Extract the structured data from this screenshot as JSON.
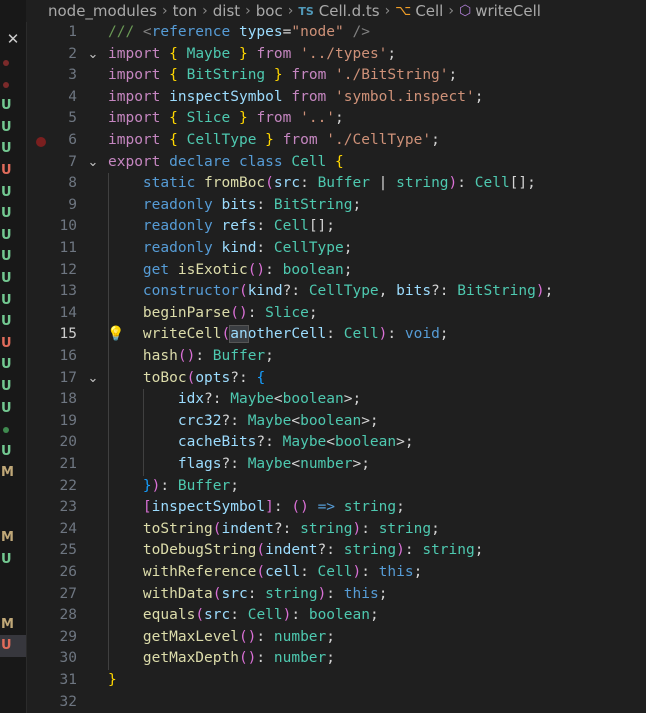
{
  "breadcrumb": {
    "items": [
      "node_modules",
      "ton",
      "dist",
      "boc"
    ],
    "file_badge": "TS",
    "file": "Cell.d.ts",
    "class_symbol": "Cell",
    "method_symbol": "writeCell"
  },
  "left_strip": {
    "close_glyph": "✕",
    "markers": [
      {
        "label": "",
        "kind": "dot-red"
      },
      {
        "label": "",
        "kind": "dot-red"
      },
      {
        "label": "U",
        "kind": "untracked"
      },
      {
        "label": "U",
        "kind": "untracked"
      },
      {
        "label": "U",
        "kind": "untracked"
      },
      {
        "label": "U",
        "kind": "deleted"
      },
      {
        "label": "U",
        "kind": "untracked"
      },
      {
        "label": "U",
        "kind": "untracked"
      },
      {
        "label": "U",
        "kind": "untracked"
      },
      {
        "label": "U",
        "kind": "untracked"
      },
      {
        "label": "U",
        "kind": "untracked"
      },
      {
        "label": "U",
        "kind": "untracked"
      },
      {
        "label": "U",
        "kind": "untracked"
      },
      {
        "label": "U",
        "kind": "deleted"
      },
      {
        "label": "U",
        "kind": "untracked"
      },
      {
        "label": "U",
        "kind": "untracked"
      },
      {
        "label": "U",
        "kind": "untracked"
      },
      {
        "label": "",
        "kind": "dot-green"
      },
      {
        "label": "U",
        "kind": "untracked"
      },
      {
        "label": "M",
        "kind": "modified"
      },
      {
        "label": "",
        "kind": "none"
      },
      {
        "label": "",
        "kind": "none"
      },
      {
        "label": "M",
        "kind": "modified"
      },
      {
        "label": "U",
        "kind": "untracked"
      },
      {
        "label": "",
        "kind": "none"
      },
      {
        "label": "",
        "kind": "none"
      },
      {
        "label": "M",
        "kind": "modified"
      },
      {
        "label": "U",
        "kind": "deleted"
      }
    ],
    "colors": {
      "untracked": "#73c991",
      "deleted": "#e06c5b",
      "modified": "#c0a878",
      "dot-red": "#7a2a2a",
      "dot-green": "#3f8a4f"
    }
  },
  "editor": {
    "active_line": 15,
    "breakpoint_line": 6,
    "lightbulb_line": 15,
    "folds": [
      2,
      7,
      17
    ],
    "lines": [
      [
        [
          "cm",
          "/// "
        ],
        [
          "tag",
          "<"
        ],
        [
          "xtag",
          "reference"
        ],
        [
          "cm",
          " "
        ],
        [
          "vr",
          "types"
        ],
        [
          "pn",
          "="
        ],
        [
          "st",
          "\"node\""
        ],
        [
          "cm",
          " "
        ],
        [
          "tag",
          "/>"
        ]
      ],
      [
        [
          "ctl",
          "import"
        ],
        [
          "pn",
          " "
        ],
        [
          "b1",
          "{"
        ],
        [
          "pn",
          " "
        ],
        [
          "ty",
          "Maybe"
        ],
        [
          "pn",
          " "
        ],
        [
          "b1",
          "}"
        ],
        [
          "pn",
          " "
        ],
        [
          "ctl",
          "from"
        ],
        [
          "pn",
          " "
        ],
        [
          "st",
          "'../types'"
        ],
        [
          "pn",
          ";"
        ]
      ],
      [
        [
          "ctl",
          "import"
        ],
        [
          "pn",
          " "
        ],
        [
          "b1",
          "{"
        ],
        [
          "pn",
          " "
        ],
        [
          "ty",
          "BitString"
        ],
        [
          "pn",
          " "
        ],
        [
          "b1",
          "}"
        ],
        [
          "pn",
          " "
        ],
        [
          "ctl",
          "from"
        ],
        [
          "pn",
          " "
        ],
        [
          "st",
          "'./BitString'"
        ],
        [
          "pn",
          ";"
        ]
      ],
      [
        [
          "ctl",
          "import"
        ],
        [
          "pn",
          " "
        ],
        [
          "vr",
          "inspectSymbol"
        ],
        [
          "pn",
          " "
        ],
        [
          "ctl",
          "from"
        ],
        [
          "pn",
          " "
        ],
        [
          "st",
          "'symbol.inspect'"
        ],
        [
          "pn",
          ";"
        ]
      ],
      [
        [
          "ctl",
          "import"
        ],
        [
          "pn",
          " "
        ],
        [
          "b1",
          "{"
        ],
        [
          "pn",
          " "
        ],
        [
          "ty",
          "Slice"
        ],
        [
          "pn",
          " "
        ],
        [
          "b1",
          "}"
        ],
        [
          "pn",
          " "
        ],
        [
          "ctl",
          "from"
        ],
        [
          "pn",
          " "
        ],
        [
          "st",
          "'..'"
        ],
        [
          "pn",
          ";"
        ]
      ],
      [
        [
          "ctl",
          "import"
        ],
        [
          "pn",
          " "
        ],
        [
          "b1",
          "{"
        ],
        [
          "pn",
          " "
        ],
        [
          "ty",
          "CellType"
        ],
        [
          "pn",
          " "
        ],
        [
          "b1",
          "}"
        ],
        [
          "pn",
          " "
        ],
        [
          "ctl",
          "from"
        ],
        [
          "pn",
          " "
        ],
        [
          "st",
          "'./CellType'"
        ],
        [
          "pn",
          ";"
        ]
      ],
      [
        [
          "ctl",
          "export"
        ],
        [
          "pn",
          " "
        ],
        [
          "kw",
          "declare"
        ],
        [
          "pn",
          " "
        ],
        [
          "kw",
          "class"
        ],
        [
          "pn",
          " "
        ],
        [
          "ty",
          "Cell"
        ],
        [
          "pn",
          " "
        ],
        [
          "b1",
          "{"
        ]
      ],
      [
        [
          "pn",
          "    "
        ],
        [
          "kw",
          "static"
        ],
        [
          "pn",
          " "
        ],
        [
          "fn",
          "fromBoc"
        ],
        [
          "b2",
          "("
        ],
        [
          "vr",
          "src"
        ],
        [
          "pn",
          ": "
        ],
        [
          "ty",
          "Buffer"
        ],
        [
          "pn",
          " | "
        ],
        [
          "ty",
          "string"
        ],
        [
          "b2",
          ")"
        ],
        [
          "pn",
          ": "
        ],
        [
          "ty",
          "Cell"
        ],
        [
          "pn",
          "[];"
        ]
      ],
      [
        [
          "pn",
          "    "
        ],
        [
          "kw",
          "readonly"
        ],
        [
          "pn",
          " "
        ],
        [
          "vr",
          "bits"
        ],
        [
          "pn",
          ": "
        ],
        [
          "ty",
          "BitString"
        ],
        [
          "pn",
          ";"
        ]
      ],
      [
        [
          "pn",
          "    "
        ],
        [
          "kw",
          "readonly"
        ],
        [
          "pn",
          " "
        ],
        [
          "vr",
          "refs"
        ],
        [
          "pn",
          ": "
        ],
        [
          "ty",
          "Cell"
        ],
        [
          "pn",
          "[];"
        ]
      ],
      [
        [
          "pn",
          "    "
        ],
        [
          "kw",
          "readonly"
        ],
        [
          "pn",
          " "
        ],
        [
          "vr",
          "kind"
        ],
        [
          "pn",
          ": "
        ],
        [
          "ty",
          "CellType"
        ],
        [
          "pn",
          ";"
        ]
      ],
      [
        [
          "pn",
          "    "
        ],
        [
          "kw",
          "get"
        ],
        [
          "pn",
          " "
        ],
        [
          "fn",
          "isExotic"
        ],
        [
          "b2",
          "()"
        ],
        [
          "pn",
          ": "
        ],
        [
          "ty",
          "boolean"
        ],
        [
          "pn",
          ";"
        ]
      ],
      [
        [
          "pn",
          "    "
        ],
        [
          "kw",
          "constructor"
        ],
        [
          "b2",
          "("
        ],
        [
          "vr",
          "kind"
        ],
        [
          "pn",
          "?: "
        ],
        [
          "ty",
          "CellType"
        ],
        [
          "pn",
          ", "
        ],
        [
          "vr",
          "bits"
        ],
        [
          "pn",
          "?: "
        ],
        [
          "ty",
          "BitString"
        ],
        [
          "b2",
          ")"
        ],
        [
          "pn",
          ";"
        ]
      ],
      [
        [
          "pn",
          "    "
        ],
        [
          "fn",
          "beginParse"
        ],
        [
          "b2",
          "()"
        ],
        [
          "pn",
          ": "
        ],
        [
          "ty",
          "Slice"
        ],
        [
          "pn",
          ";"
        ]
      ],
      [
        [
          "pn",
          "    "
        ],
        [
          "fn",
          "writeCell"
        ],
        [
          "b2",
          "("
        ],
        [
          "hl",
          "another"
        ],
        [
          "vr",
          "Cell"
        ],
        [
          "pn",
          ": "
        ],
        [
          "ty",
          "Cell"
        ],
        [
          "b2",
          ")"
        ],
        [
          "pn",
          ": "
        ],
        [
          "kw",
          "void"
        ],
        [
          "pn",
          ";"
        ]
      ],
      [
        [
          "pn",
          "    "
        ],
        [
          "fn",
          "hash"
        ],
        [
          "b2",
          "()"
        ],
        [
          "pn",
          ": "
        ],
        [
          "ty",
          "Buffer"
        ],
        [
          "pn",
          ";"
        ]
      ],
      [
        [
          "pn",
          "    "
        ],
        [
          "fn",
          "toBoc"
        ],
        [
          "b2",
          "("
        ],
        [
          "vr",
          "opts"
        ],
        [
          "pn",
          "?: "
        ],
        [
          "b3",
          "{"
        ]
      ],
      [
        [
          "pn",
          "        "
        ],
        [
          "vr",
          "idx"
        ],
        [
          "pn",
          "?: "
        ],
        [
          "ty",
          "Maybe"
        ],
        [
          "pn",
          "<"
        ],
        [
          "ty",
          "boolean"
        ],
        [
          "pn",
          ">;"
        ]
      ],
      [
        [
          "pn",
          "        "
        ],
        [
          "vr",
          "crc32"
        ],
        [
          "pn",
          "?: "
        ],
        [
          "ty",
          "Maybe"
        ],
        [
          "pn",
          "<"
        ],
        [
          "ty",
          "boolean"
        ],
        [
          "pn",
          ">;"
        ]
      ],
      [
        [
          "pn",
          "        "
        ],
        [
          "vr",
          "cacheBits"
        ],
        [
          "pn",
          "?: "
        ],
        [
          "ty",
          "Maybe"
        ],
        [
          "pn",
          "<"
        ],
        [
          "ty",
          "boolean"
        ],
        [
          "pn",
          ">;"
        ]
      ],
      [
        [
          "pn",
          "        "
        ],
        [
          "vr",
          "flags"
        ],
        [
          "pn",
          "?: "
        ],
        [
          "ty",
          "Maybe"
        ],
        [
          "pn",
          "<"
        ],
        [
          "ty",
          "number"
        ],
        [
          "pn",
          ">;"
        ]
      ],
      [
        [
          "pn",
          "    "
        ],
        [
          "b3",
          "}"
        ],
        [
          "b2",
          ")"
        ],
        [
          "pn",
          ": "
        ],
        [
          "ty",
          "Buffer"
        ],
        [
          "pn",
          ";"
        ]
      ],
      [
        [
          "pn",
          "    "
        ],
        [
          "b2",
          "["
        ],
        [
          "vr",
          "inspectSymbol"
        ],
        [
          "b2",
          "]"
        ],
        [
          "pn",
          ": "
        ],
        [
          "b2",
          "()"
        ],
        [
          "pn",
          " "
        ],
        [
          "kw",
          "=>"
        ],
        [
          "pn",
          " "
        ],
        [
          "ty",
          "string"
        ],
        [
          "pn",
          ";"
        ]
      ],
      [
        [
          "pn",
          "    "
        ],
        [
          "fn",
          "toString"
        ],
        [
          "b2",
          "("
        ],
        [
          "vr",
          "indent"
        ],
        [
          "pn",
          "?: "
        ],
        [
          "ty",
          "string"
        ],
        [
          "b2",
          ")"
        ],
        [
          "pn",
          ": "
        ],
        [
          "ty",
          "string"
        ],
        [
          "pn",
          ";"
        ]
      ],
      [
        [
          "pn",
          "    "
        ],
        [
          "fn",
          "toDebugString"
        ],
        [
          "b2",
          "("
        ],
        [
          "vr",
          "indent"
        ],
        [
          "pn",
          "?: "
        ],
        [
          "ty",
          "string"
        ],
        [
          "b2",
          ")"
        ],
        [
          "pn",
          ": "
        ],
        [
          "ty",
          "string"
        ],
        [
          "pn",
          ";"
        ]
      ],
      [
        [
          "pn",
          "    "
        ],
        [
          "fn",
          "withReference"
        ],
        [
          "b2",
          "("
        ],
        [
          "vr",
          "cell"
        ],
        [
          "pn",
          ": "
        ],
        [
          "ty",
          "Cell"
        ],
        [
          "b2",
          ")"
        ],
        [
          "pn",
          ": "
        ],
        [
          "kw",
          "this"
        ],
        [
          "pn",
          ";"
        ]
      ],
      [
        [
          "pn",
          "    "
        ],
        [
          "fn",
          "withData"
        ],
        [
          "b2",
          "("
        ],
        [
          "vr",
          "src"
        ],
        [
          "pn",
          ": "
        ],
        [
          "ty",
          "string"
        ],
        [
          "b2",
          ")"
        ],
        [
          "pn",
          ": "
        ],
        [
          "kw",
          "this"
        ],
        [
          "pn",
          ";"
        ]
      ],
      [
        [
          "pn",
          "    "
        ],
        [
          "fn",
          "equals"
        ],
        [
          "b2",
          "("
        ],
        [
          "vr",
          "src"
        ],
        [
          "pn",
          ": "
        ],
        [
          "ty",
          "Cell"
        ],
        [
          "b2",
          ")"
        ],
        [
          "pn",
          ": "
        ],
        [
          "ty",
          "boolean"
        ],
        [
          "pn",
          ";"
        ]
      ],
      [
        [
          "pn",
          "    "
        ],
        [
          "fn",
          "getMaxLevel"
        ],
        [
          "b2",
          "()"
        ],
        [
          "pn",
          ": "
        ],
        [
          "ty",
          "number"
        ],
        [
          "pn",
          ";"
        ]
      ],
      [
        [
          "pn",
          "    "
        ],
        [
          "fn",
          "getMaxDepth"
        ],
        [
          "b2",
          "()"
        ],
        [
          "pn",
          ": "
        ],
        [
          "ty",
          "number"
        ],
        [
          "pn",
          ";"
        ]
      ],
      [
        [
          "b1",
          "}"
        ]
      ],
      []
    ]
  }
}
